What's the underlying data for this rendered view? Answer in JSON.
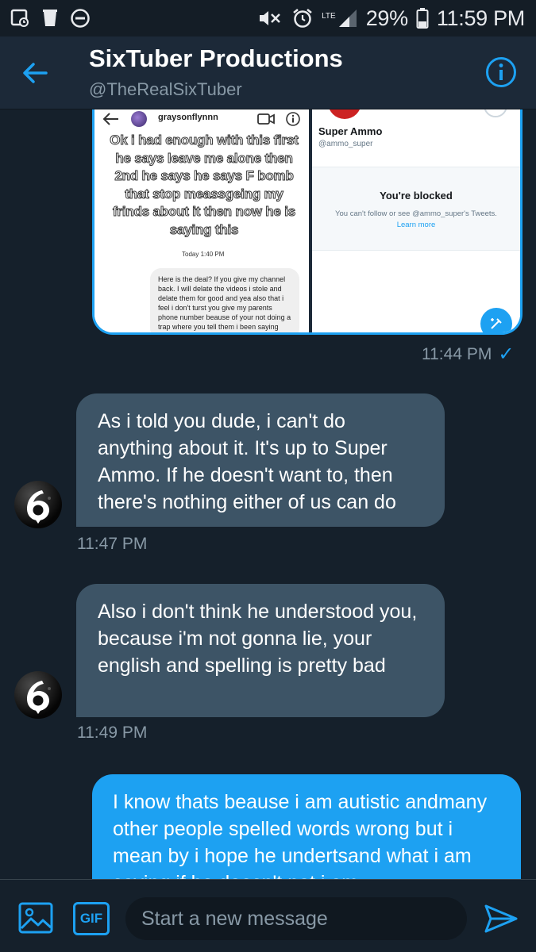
{
  "status_bar": {
    "network": "LTE",
    "battery": "29%",
    "time": "11:59 PM"
  },
  "header": {
    "title": "SixTuber Productions",
    "handle": "@TheRealSixTuber"
  },
  "attachment": {
    "instagram": {
      "username": "graysonflynnn",
      "overlay_text": "Ok i had enough with this first he says leave me alone then 2nd he says he says F bomb that stop meassgeing my frinds about it then now he is saying this",
      "time": "Today 1:40 PM",
      "message": "Here is the deal? If you give my channel back. I will delate the videos i stole and delate them for good and yea also that i feel i don't turst you give my parents phone number beause of your not doing a trap where you tell them i been saying and rude things id you not"
    },
    "twitter": {
      "name": "Super Ammo",
      "handle": "@ammo_super",
      "blocked_title": "You're blocked",
      "blocked_message": "You can't follow or see @ammo_super's Tweets.",
      "learn_more": "Learn more"
    }
  },
  "messages": [
    {
      "direction": "sent",
      "kind": "image",
      "time": "11:44 PM",
      "read_receipt": "✓"
    },
    {
      "direction": "received",
      "text": "As i told you dude, i can't do anything about it. It's up to Super Ammo. If he doesn't want to, then there's nothing either of us can do",
      "time": "11:47 PM"
    },
    {
      "direction": "received",
      "text": "Also i don't think he understood you, because i'm not gonna lie, your english and spelling is pretty bad",
      "time": "11:49 PM"
    },
    {
      "direction": "sent",
      "text": "I know thats beause i am autistic andmany other people spelled words wrong but i mean by i hope he undertsand what i am saying if he doesn't not i am"
    }
  ],
  "composer": {
    "gif_label": "GIF",
    "placeholder": "Start a new message"
  },
  "colors": {
    "accent": "#1da1f2",
    "background": "#15202b",
    "header": "#1c2938",
    "bubble_received": "#3d5466",
    "secondary_text": "#8899a6"
  },
  "icons": {
    "back": "arrow-left-icon",
    "info": "info-icon",
    "media": "image-icon",
    "send": "send-icon"
  }
}
